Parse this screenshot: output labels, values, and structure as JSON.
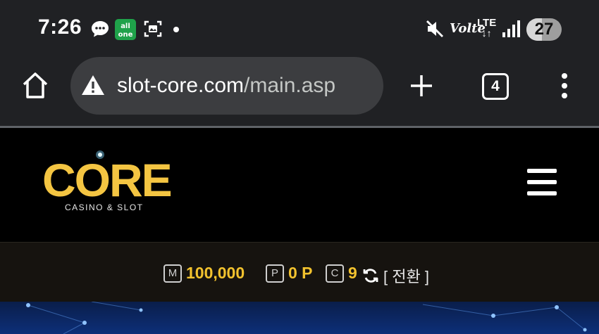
{
  "status_bar": {
    "time": "7:26",
    "battery": "27",
    "network": "LTE",
    "volte": "Volte"
  },
  "browser": {
    "url_domain": "slot-core.com",
    "url_path": "/main.asp",
    "tab_count": "4"
  },
  "site": {
    "logo_word": "CORE",
    "logo_subtitle": "CASINO & SLOT"
  },
  "balance": {
    "money_badge": "M",
    "money": "100,000",
    "points_badge": "P",
    "points": "0 P",
    "coupon_badge": "C",
    "coupon": "9",
    "switch_label": "[ 전환 ]"
  },
  "colors": {
    "accent_gold": "#f2c22e",
    "chrome_bg": "#202124",
    "banner_blue": "#0d2f78"
  }
}
